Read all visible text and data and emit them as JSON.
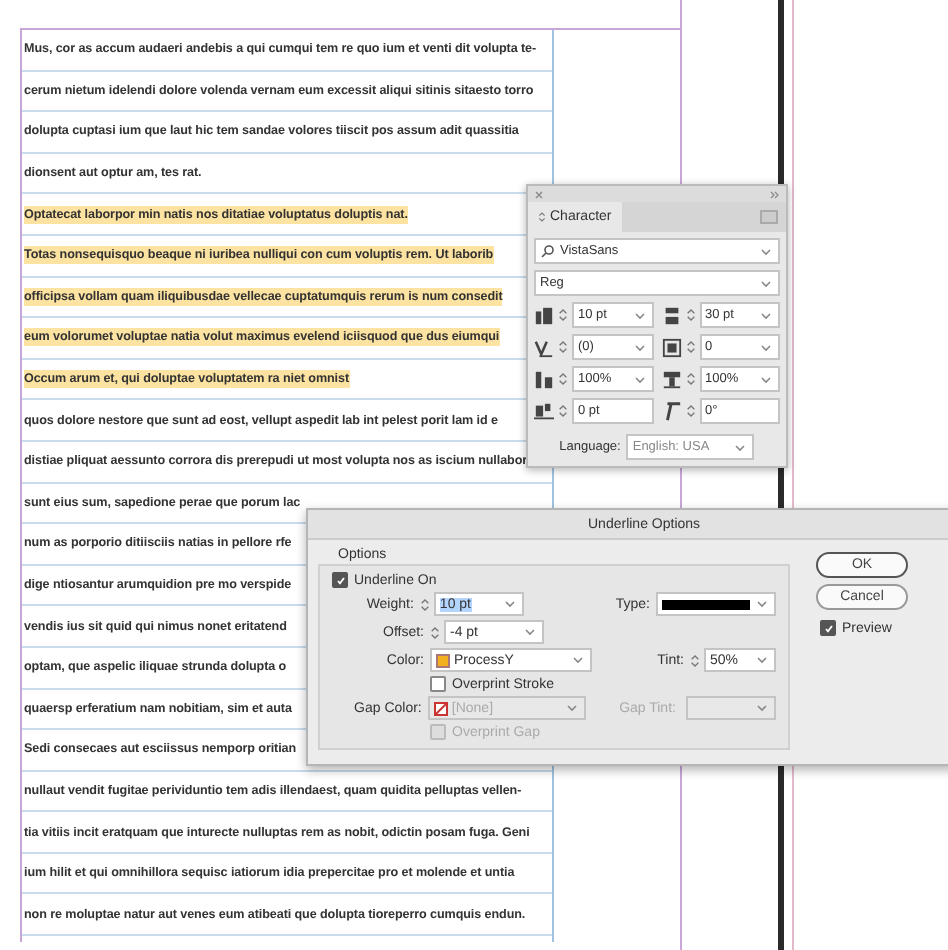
{
  "document": {
    "lines": [
      {
        "text": "Mus, cor as accum audaeri andebis a qui cumqui tem re quo ium et venti dit volupta te-",
        "highlighted": false
      },
      {
        "text": "cerum nietum idelendi dolore volenda vernam eum excessit aliqui sitinis sitaesto torro",
        "highlighted": false
      },
      {
        "text": "dolupta cuptasi ium que laut hic tem sandae volores tiiscit pos assum adit quassitia",
        "highlighted": false
      },
      {
        "text": "dionsent aut optur am, tes rat.",
        "highlighted": false
      },
      {
        "text": "Optatecat laborpor min natis nos ditatiae voluptatus doluptis nat.",
        "highlighted": true
      },
      {
        "text": "Totas nonsequisquo beaque ni iuribea nulliqui con cum voluptis rem. Ut laborib",
        "highlighted": true
      },
      {
        "text": "officipsa vollam quam iliquibusdae vellecae cuptatumquis rerum is num consedit",
        "highlighted": true
      },
      {
        "text": "eum volorumet voluptae natia volut maximus evelend iciisquod que dus eiumqui",
        "highlighted": true
      },
      {
        "text": "Occum arum et, qui doluptae voluptatem ra niet omnist",
        "highlighted": true
      },
      {
        "text": "quos dolore nestore que sunt ad eost, vellupt aspedit lab int pelest porit lam id e",
        "highlighted": false
      },
      {
        "text": "distiae pliquat aessunto corrora dis prerepudi ut most volupta nos as iscium nullabor",
        "highlighted": false
      },
      {
        "text": "sunt eius sum, sapedione perae que porum lac",
        "highlighted": false
      },
      {
        "text": "num as porporio ditiisciis natias in pellore rfe",
        "highlighted": false
      },
      {
        "text": "dige ntiosantur arumquidion pre mo verspide",
        "highlighted": false
      },
      {
        "text": "vendis ius sit quid qui nimus nonet eritatend",
        "highlighted": false
      },
      {
        "text": "optam, que aspelic iliquae strunda dolupta o",
        "highlighted": false
      },
      {
        "text": "quaersp erferatium nam nobitiam, sim et auta",
        "highlighted": false
      },
      {
        "text": "Sedi consecaes aut esciissus nemporp oritian",
        "highlighted": false
      },
      {
        "text": "nullaut vendit fugitae perividuntio tem adis illendaest, quam quidita pelluptas vellen-",
        "highlighted": false
      },
      {
        "text": "tia vitiis incit eratquam que inturecte nulluptas rem as nobit, odictin posam fuga. Geni",
        "highlighted": false
      },
      {
        "text": "ium hilit et qui omnihillora sequisc iatiorum idia prepercitae pro et molende et untia",
        "highlighted": false
      },
      {
        "text": "non re moluptae natur aut venes eum atibeati que dolupta tioreperro cumquis endun.",
        "highlighted": false
      }
    ]
  },
  "character_panel": {
    "title": "Character",
    "font_family": "VistaSans",
    "font_style": "Reg",
    "fields": [
      {
        "kind": "size",
        "value": "10 pt",
        "dropdown": true
      },
      {
        "kind": "leading",
        "value": "30 pt",
        "dropdown": true
      },
      {
        "kind": "kerning",
        "value": "(0)",
        "dropdown": true
      },
      {
        "kind": "tracking",
        "value": "0",
        "dropdown": true
      },
      {
        "kind": "vscale",
        "value": "100%",
        "dropdown": true
      },
      {
        "kind": "hscale",
        "value": "100%",
        "dropdown": true
      },
      {
        "kind": "baseline",
        "value": "0 pt",
        "dropdown": false
      },
      {
        "kind": "skew",
        "value": "0°",
        "dropdown": false
      }
    ],
    "language_label": "Language:",
    "language": "English: USA"
  },
  "underline_dialog": {
    "title": "Underline Options",
    "group_label": "Options",
    "underline_on": {
      "label": "Underline On",
      "checked": true
    },
    "weight": {
      "label": "Weight:",
      "value": "10 pt"
    },
    "offset": {
      "label": "Offset:",
      "value": "-4 pt"
    },
    "type": {
      "label": "Type:"
    },
    "color": {
      "label": "Color:",
      "value": "ProcessY"
    },
    "tint": {
      "label": "Tint:",
      "value": "50%"
    },
    "overprint_stroke": {
      "label": "Overprint Stroke",
      "checked": false
    },
    "gap_color": {
      "label": "Gap Color:",
      "value": "[None]",
      "disabled": true
    },
    "gap_tint": {
      "label": "Gap Tint:",
      "disabled": true
    },
    "overprint_gap": {
      "label": "Overprint Gap",
      "checked": false,
      "disabled": true
    },
    "buttons": [
      {
        "label": "OK",
        "default": true
      },
      {
        "label": "Cancel",
        "default": false
      }
    ],
    "preview": {
      "label": "Preview",
      "checked": true
    }
  }
}
